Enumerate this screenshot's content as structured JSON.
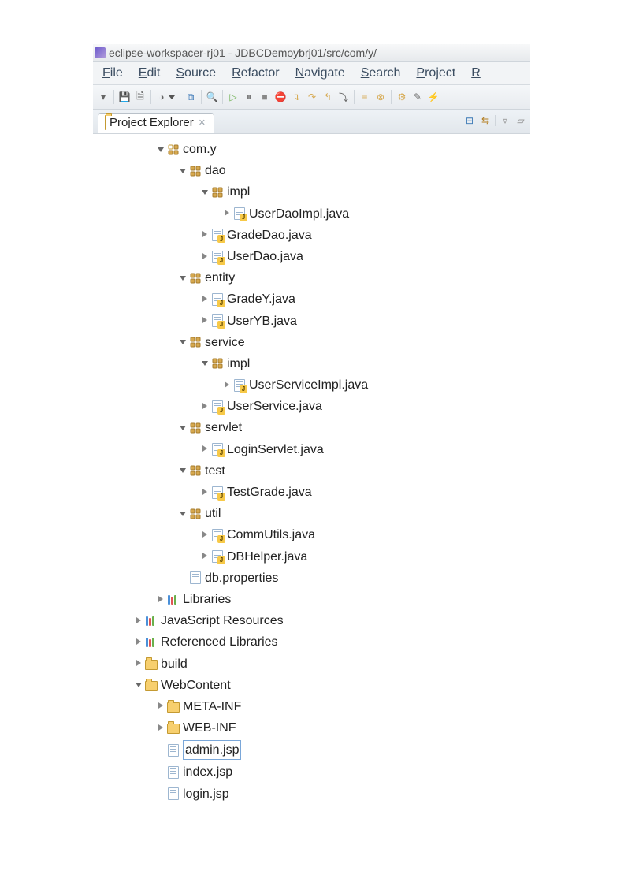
{
  "title": "eclipse-workspacer-rj01 - JDBCDemoybrj01/src/com/y/",
  "menu": [
    "File",
    "Edit",
    "Source",
    "Refactor",
    "Navigate",
    "Search",
    "Project",
    "R"
  ],
  "explorer_tab": "Project Explorer",
  "tree": {
    "com_y": "com.y",
    "dao": "dao",
    "dao_impl": "impl",
    "UserDaoImpl": "UserDaoImpl.java",
    "GradeDao": "GradeDao.java",
    "UserDao": "UserDao.java",
    "entity": "entity",
    "GradeY": "GradeY.java",
    "UserYB": "UserYB.java",
    "service": "service",
    "service_impl": "impl",
    "UserServiceImpl": "UserServiceImpl.java",
    "UserService": "UserService.java",
    "servlet": "servlet",
    "LoginServlet": "LoginServlet.java",
    "test": "test",
    "TestGrade": "TestGrade.java",
    "util": "util",
    "CommUtils": "CommUtils.java",
    "DBHelper": "DBHelper.java",
    "db_properties": "db.properties",
    "Libraries": "Libraries",
    "JavaScriptResources": "JavaScript Resources",
    "ReferencedLibraries": "Referenced Libraries",
    "build": "build",
    "WebContent": "WebContent",
    "META_INF": "META-INF",
    "WEB_INF": "WEB-INF",
    "admin_jsp": "admin.jsp",
    "index_jsp": "index.jsp",
    "login_jsp": "login.jsp"
  }
}
